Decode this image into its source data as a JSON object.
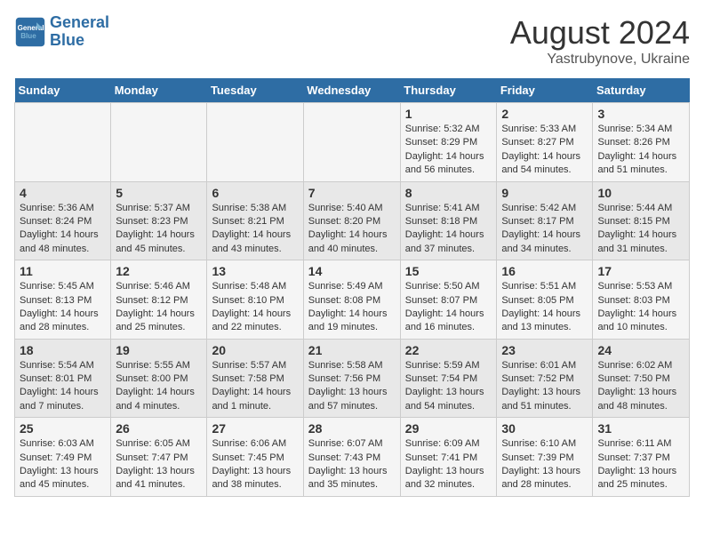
{
  "logo": {
    "text_general": "General",
    "text_blue": "Blue"
  },
  "title": "August 2024",
  "subtitle": "Yastrubynove, Ukraine",
  "days_of_week": [
    "Sunday",
    "Monday",
    "Tuesday",
    "Wednesday",
    "Thursday",
    "Friday",
    "Saturday"
  ],
  "weeks": [
    [
      {
        "day": "",
        "info": ""
      },
      {
        "day": "",
        "info": ""
      },
      {
        "day": "",
        "info": ""
      },
      {
        "day": "",
        "info": ""
      },
      {
        "day": "1",
        "info": "Sunrise: 5:32 AM\nSunset: 8:29 PM\nDaylight: 14 hours\nand 56 minutes."
      },
      {
        "day": "2",
        "info": "Sunrise: 5:33 AM\nSunset: 8:27 PM\nDaylight: 14 hours\nand 54 minutes."
      },
      {
        "day": "3",
        "info": "Sunrise: 5:34 AM\nSunset: 8:26 PM\nDaylight: 14 hours\nand 51 minutes."
      }
    ],
    [
      {
        "day": "4",
        "info": "Sunrise: 5:36 AM\nSunset: 8:24 PM\nDaylight: 14 hours\nand 48 minutes."
      },
      {
        "day": "5",
        "info": "Sunrise: 5:37 AM\nSunset: 8:23 PM\nDaylight: 14 hours\nand 45 minutes."
      },
      {
        "day": "6",
        "info": "Sunrise: 5:38 AM\nSunset: 8:21 PM\nDaylight: 14 hours\nand 43 minutes."
      },
      {
        "day": "7",
        "info": "Sunrise: 5:40 AM\nSunset: 8:20 PM\nDaylight: 14 hours\nand 40 minutes."
      },
      {
        "day": "8",
        "info": "Sunrise: 5:41 AM\nSunset: 8:18 PM\nDaylight: 14 hours\nand 37 minutes."
      },
      {
        "day": "9",
        "info": "Sunrise: 5:42 AM\nSunset: 8:17 PM\nDaylight: 14 hours\nand 34 minutes."
      },
      {
        "day": "10",
        "info": "Sunrise: 5:44 AM\nSunset: 8:15 PM\nDaylight: 14 hours\nand 31 minutes."
      }
    ],
    [
      {
        "day": "11",
        "info": "Sunrise: 5:45 AM\nSunset: 8:13 PM\nDaylight: 14 hours\nand 28 minutes."
      },
      {
        "day": "12",
        "info": "Sunrise: 5:46 AM\nSunset: 8:12 PM\nDaylight: 14 hours\nand 25 minutes."
      },
      {
        "day": "13",
        "info": "Sunrise: 5:48 AM\nSunset: 8:10 PM\nDaylight: 14 hours\nand 22 minutes."
      },
      {
        "day": "14",
        "info": "Sunrise: 5:49 AM\nSunset: 8:08 PM\nDaylight: 14 hours\nand 19 minutes."
      },
      {
        "day": "15",
        "info": "Sunrise: 5:50 AM\nSunset: 8:07 PM\nDaylight: 14 hours\nand 16 minutes."
      },
      {
        "day": "16",
        "info": "Sunrise: 5:51 AM\nSunset: 8:05 PM\nDaylight: 14 hours\nand 13 minutes."
      },
      {
        "day": "17",
        "info": "Sunrise: 5:53 AM\nSunset: 8:03 PM\nDaylight: 14 hours\nand 10 minutes."
      }
    ],
    [
      {
        "day": "18",
        "info": "Sunrise: 5:54 AM\nSunset: 8:01 PM\nDaylight: 14 hours\nand 7 minutes."
      },
      {
        "day": "19",
        "info": "Sunrise: 5:55 AM\nSunset: 8:00 PM\nDaylight: 14 hours\nand 4 minutes."
      },
      {
        "day": "20",
        "info": "Sunrise: 5:57 AM\nSunset: 7:58 PM\nDaylight: 14 hours\nand 1 minute."
      },
      {
        "day": "21",
        "info": "Sunrise: 5:58 AM\nSunset: 7:56 PM\nDaylight: 13 hours\nand 57 minutes."
      },
      {
        "day": "22",
        "info": "Sunrise: 5:59 AM\nSunset: 7:54 PM\nDaylight: 13 hours\nand 54 minutes."
      },
      {
        "day": "23",
        "info": "Sunrise: 6:01 AM\nSunset: 7:52 PM\nDaylight: 13 hours\nand 51 minutes."
      },
      {
        "day": "24",
        "info": "Sunrise: 6:02 AM\nSunset: 7:50 PM\nDaylight: 13 hours\nand 48 minutes."
      }
    ],
    [
      {
        "day": "25",
        "info": "Sunrise: 6:03 AM\nSunset: 7:49 PM\nDaylight: 13 hours\nand 45 minutes."
      },
      {
        "day": "26",
        "info": "Sunrise: 6:05 AM\nSunset: 7:47 PM\nDaylight: 13 hours\nand 41 minutes."
      },
      {
        "day": "27",
        "info": "Sunrise: 6:06 AM\nSunset: 7:45 PM\nDaylight: 13 hours\nand 38 minutes."
      },
      {
        "day": "28",
        "info": "Sunrise: 6:07 AM\nSunset: 7:43 PM\nDaylight: 13 hours\nand 35 minutes."
      },
      {
        "day": "29",
        "info": "Sunrise: 6:09 AM\nSunset: 7:41 PM\nDaylight: 13 hours\nand 32 minutes."
      },
      {
        "day": "30",
        "info": "Sunrise: 6:10 AM\nSunset: 7:39 PM\nDaylight: 13 hours\nand 28 minutes."
      },
      {
        "day": "31",
        "info": "Sunrise: 6:11 AM\nSunset: 7:37 PM\nDaylight: 13 hours\nand 25 minutes."
      }
    ]
  ]
}
